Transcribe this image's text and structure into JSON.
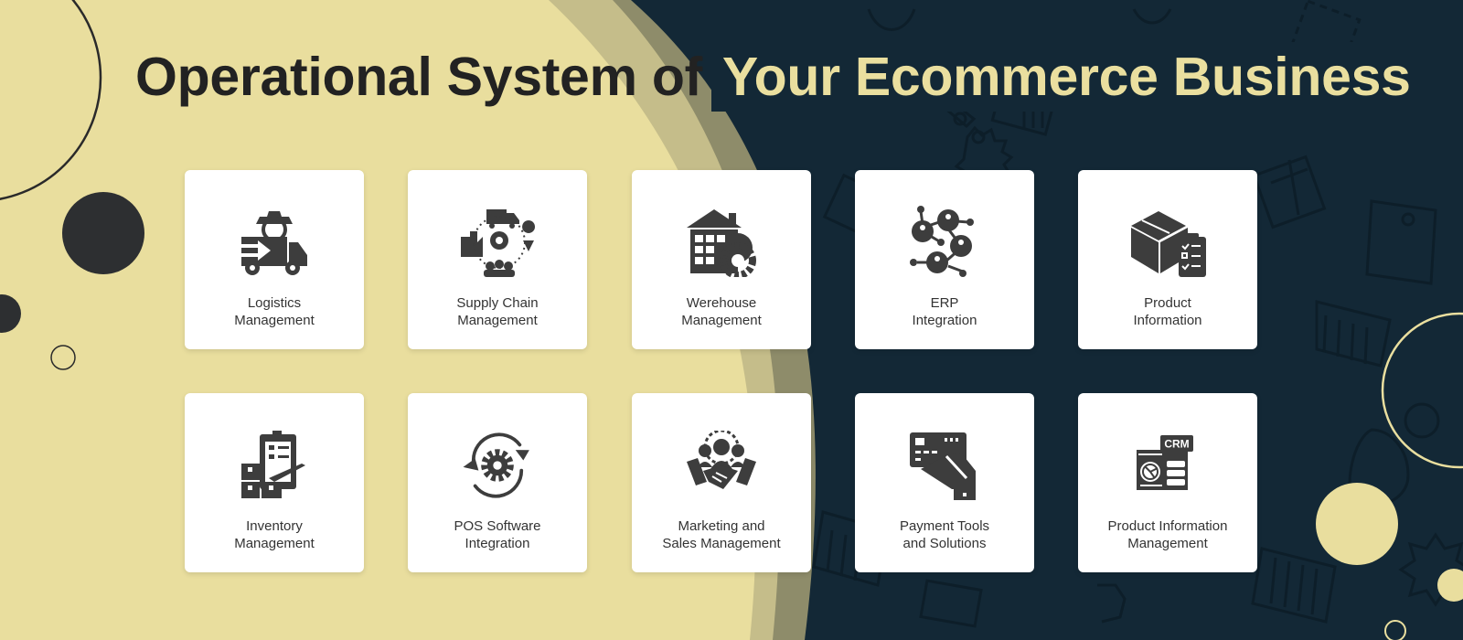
{
  "banner": {
    "title_part1": "Operational System of",
    "title_part2": "Your Ecommerce Business",
    "colors": {
      "cream": "#e9de9e",
      "navy": "#132836",
      "dark_text": "#222222",
      "icon": "#3d3d3d",
      "card": "#ffffff",
      "highlight_text": "#eadf9f"
    }
  },
  "cards": [
    {
      "icon": "logistics-truck-gear-icon",
      "line1": "Logistics",
      "line2": "Management"
    },
    {
      "icon": "supply-chain-network-icon",
      "line1": "Supply Chain",
      "line2": "Management"
    },
    {
      "icon": "warehouse-gear-icon",
      "line1": "Werehouse",
      "line2": "Management"
    },
    {
      "icon": "erp-integration-network-icon",
      "line1": "ERP",
      "line2": "Integration"
    },
    {
      "icon": "product-box-checklist-icon",
      "line1": "Product",
      "line2": "Information"
    },
    {
      "icon": "inventory-clipboard-boxes-icon",
      "line1": "Inventory",
      "line2": "Management"
    },
    {
      "icon": "pos-sync-gear-icon",
      "line1": "POS Software",
      "line2": "Integration"
    },
    {
      "icon": "marketing-handshake-team-icon",
      "line1": "Marketing and",
      "line2": "Sales Management"
    },
    {
      "icon": "payment-card-hand-icon",
      "line1": "Payment Tools",
      "line2": "and Solutions"
    },
    {
      "icon": "crm-dashboard-icon",
      "line1": "Product Information",
      "line2": "Management",
      "badge": "CRM"
    }
  ]
}
